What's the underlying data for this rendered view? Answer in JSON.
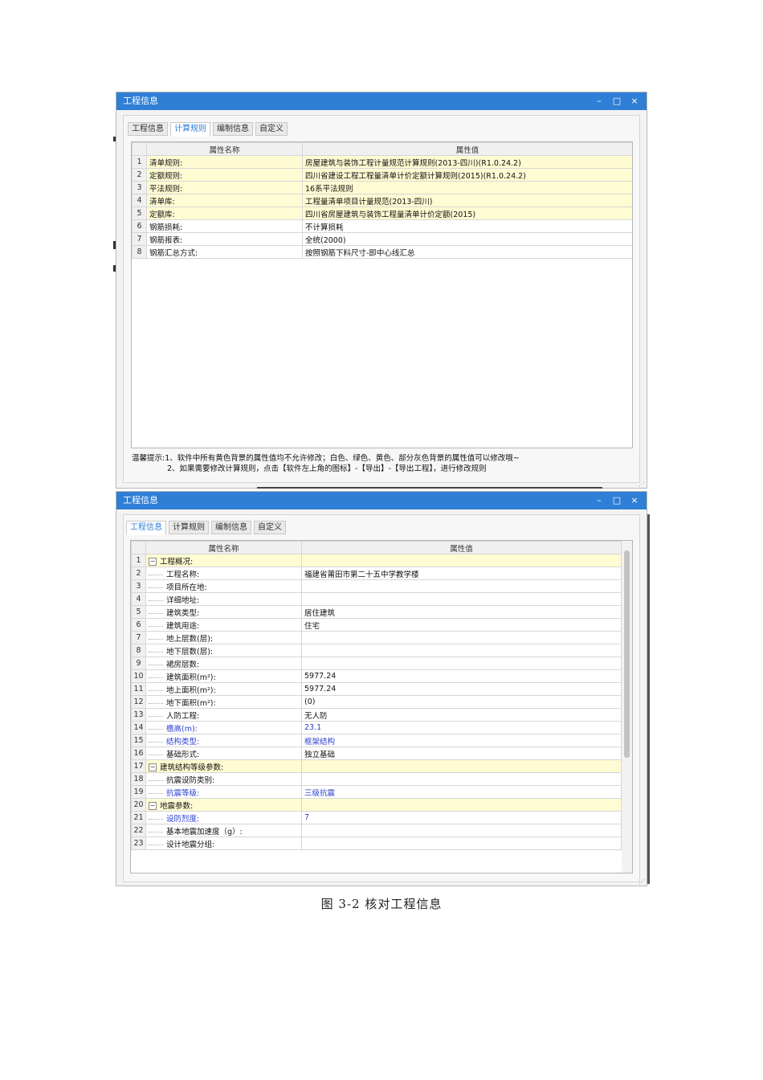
{
  "window1": {
    "title": "工程信息",
    "controls": {
      "minimize": "–",
      "maximize": "□",
      "close": "×"
    },
    "tabs": [
      {
        "label": "工程信息",
        "active": false
      },
      {
        "label": "计算规则",
        "active": true
      },
      {
        "label": "编制信息",
        "active": false
      },
      {
        "label": "自定义",
        "active": false
      }
    ],
    "columns": {
      "name": "属性名称",
      "value": "属性值"
    },
    "rows": [
      {
        "num": "1",
        "name": "清单规则:",
        "value": "房屋建筑与装饰工程计量规范计算规则(2013-四川)(R1.0.24.2)",
        "yellow": true
      },
      {
        "num": "2",
        "name": "定额规则:",
        "value": "四川省建设工程工程量清单计价定额计算规则(2015)(R1.0.24.2)",
        "yellow": true
      },
      {
        "num": "3",
        "name": "平法规则:",
        "value": "16系平法规则",
        "yellow": true
      },
      {
        "num": "4",
        "name": "清单库:",
        "value": "工程量清单项目计量规范(2013-四川)",
        "yellow": true
      },
      {
        "num": "5",
        "name": "定额库:",
        "value": "四川省房屋建筑与装饰工程量清单计价定额(2015)",
        "yellow": true
      },
      {
        "num": "6",
        "name": "钢筋损耗:",
        "value": "不计算损耗",
        "yellow": false
      },
      {
        "num": "7",
        "name": "钢筋报表:",
        "value": "全统(2000)",
        "yellow": false
      },
      {
        "num": "8",
        "name": "钢筋汇总方式:",
        "value": "按照钢筋下料尺寸-即中心线汇总",
        "yellow": false
      }
    ],
    "hint_line1": "温馨提示:1、软件中所有黄色背景的属性值均不允许修改；白色、绿色、黄色、部分灰色背景的属性值可以修改哦~",
    "hint_line2": "2、如果需要修改计算规则，点击【软件左上角的图标】-【导出】-【导出工程】，进行修改规则"
  },
  "window2": {
    "title": "工程信息",
    "controls": {
      "minimize": "–",
      "maximize": "□",
      "close": "×"
    },
    "tabs": [
      {
        "label": "工程信息",
        "active": true
      },
      {
        "label": "计算规则",
        "active": false
      },
      {
        "label": "编制信息",
        "active": false
      },
      {
        "label": "自定义",
        "active": false
      }
    ],
    "columns": {
      "name": "属性名称",
      "value": "属性值"
    },
    "rows": [
      {
        "num": "1",
        "name": "工程概况:",
        "value": "",
        "group": true,
        "yellow": true
      },
      {
        "num": "2",
        "name": "工程名称:",
        "value": "福建省莆田市第二十五中学教学楼"
      },
      {
        "num": "3",
        "name": "项目所在地:",
        "value": ""
      },
      {
        "num": "4",
        "name": "详细地址:",
        "value": ""
      },
      {
        "num": "5",
        "name": "建筑类型:",
        "value": "居住建筑"
      },
      {
        "num": "6",
        "name": "建筑用途:",
        "value": "住宅"
      },
      {
        "num": "7",
        "name": "地上层数(层):",
        "value": ""
      },
      {
        "num": "8",
        "name": "地下层数(层):",
        "value": ""
      },
      {
        "num": "9",
        "name": "裙房层数:",
        "value": ""
      },
      {
        "num": "10",
        "name": "建筑面积(m²):",
        "value": "5977.24"
      },
      {
        "num": "11",
        "name": "地上面积(m²):",
        "value": "5977.24"
      },
      {
        "num": "12",
        "name": "地下面积(m²):",
        "value": "(0)"
      },
      {
        "num": "13",
        "name": "人防工程:",
        "value": "无人防"
      },
      {
        "num": "14",
        "name": "檐高(m):",
        "value": "23.1",
        "blue": true
      },
      {
        "num": "15",
        "name": "结构类型:",
        "value": "框架结构",
        "blue": true
      },
      {
        "num": "16",
        "name": "基础形式:",
        "value": "独立基础"
      },
      {
        "num": "17",
        "name": "建筑结构等级参数:",
        "value": "",
        "group": true,
        "yellow": true
      },
      {
        "num": "18",
        "name": "抗震设防类别:",
        "value": ""
      },
      {
        "num": "19",
        "name": "抗震等级:",
        "value": "三级抗震",
        "blue": true
      },
      {
        "num": "20",
        "name": "地震参数:",
        "value": "",
        "group": true,
        "yellow": true
      },
      {
        "num": "21",
        "name": "设防烈度:",
        "value": "7",
        "blue": true
      },
      {
        "num": "22",
        "name": "基本地震加速度（g）:",
        "value": ""
      },
      {
        "num": "23",
        "name": "设计地震分组:",
        "value": ""
      }
    ],
    "collapse_glyph": "−"
  },
  "caption": "图 3-2   核对工程信息"
}
